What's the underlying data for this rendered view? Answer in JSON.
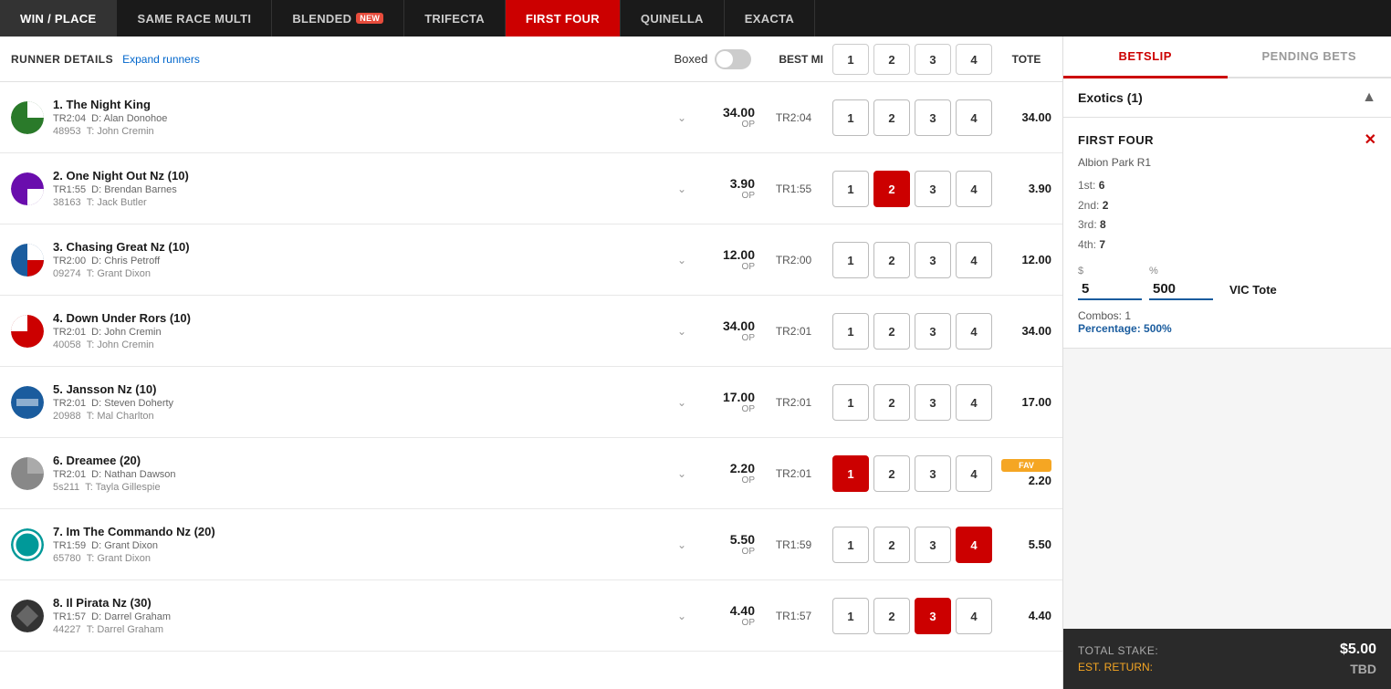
{
  "nav": {
    "tabs": [
      {
        "id": "win-place",
        "label": "WIN / PLACE",
        "active": false
      },
      {
        "id": "same-race-multi",
        "label": "SAME RACE MULTI",
        "active": false
      },
      {
        "id": "blended",
        "label": "BLENDED",
        "active": false,
        "badge": "NEW"
      },
      {
        "id": "trifecta",
        "label": "TRIFECTA",
        "active": false
      },
      {
        "id": "first-four",
        "label": "FIRST FOUR",
        "active": true
      },
      {
        "id": "quinella",
        "label": "QUINELLA",
        "active": false
      },
      {
        "id": "exacta",
        "label": "EXACTA",
        "active": false
      }
    ]
  },
  "table": {
    "runner_details_label": "RUNNER DETAILS",
    "expand_runners_label": "Expand runners",
    "boxed_label": "Boxed",
    "best_mi_label": "BEST MI",
    "tote_label": "Tote",
    "position_headers": [
      "1",
      "2",
      "3",
      "4"
    ]
  },
  "runners": [
    {
      "number": 1,
      "name": "1. The Night King",
      "tr": "TR2:04",
      "driver": "D: Alan Donohoe",
      "trainer": "T: John Cremin",
      "id": "48953",
      "odds": "34.00",
      "odds_type": "OP",
      "runner_tr": "TR2:04",
      "tote": "34.00",
      "silk_class": "silk-green",
      "positions": [
        {
          "label": "1",
          "selected": false
        },
        {
          "label": "2",
          "selected": false
        },
        {
          "label": "3",
          "selected": false
        },
        {
          "label": "4",
          "selected": false
        }
      ],
      "fav": false
    },
    {
      "number": 2,
      "name": "2. One Night Out Nz (10)",
      "tr": "TR1:55",
      "driver": "D: Brendan Barnes",
      "trainer": "T: Jack Butler",
      "id": "38163",
      "odds": "3.90",
      "odds_type": "OP",
      "runner_tr": "TR1:55",
      "tote": "3.90",
      "silk_class": "silk-purple-white",
      "positions": [
        {
          "label": "1",
          "selected": false
        },
        {
          "label": "2",
          "selected": true
        },
        {
          "label": "3",
          "selected": false
        },
        {
          "label": "4",
          "selected": false
        }
      ],
      "fav": false
    },
    {
      "number": 3,
      "name": "3. Chasing Great Nz (10)",
      "tr": "TR2:00",
      "driver": "D: Chris Petroff",
      "trainer": "T: Grant Dixon",
      "id": "09274",
      "odds": "12.00",
      "odds_type": "OP",
      "runner_tr": "TR2:00",
      "tote": "12.00",
      "silk_class": "silk-multi",
      "positions": [
        {
          "label": "1",
          "selected": false
        },
        {
          "label": "2",
          "selected": false
        },
        {
          "label": "3",
          "selected": false
        },
        {
          "label": "4",
          "selected": false
        }
      ],
      "fav": false
    },
    {
      "number": 4,
      "name": "4. Down Under Rors (10)",
      "tr": "TR2:01",
      "driver": "D: John Cremin",
      "trainer": "T: John Cremin",
      "id": "40058",
      "odds": "34.00",
      "odds_type": "OP",
      "runner_tr": "TR2:01",
      "tote": "34.00",
      "silk_class": "silk-red-white",
      "positions": [
        {
          "label": "1",
          "selected": false
        },
        {
          "label": "2",
          "selected": false
        },
        {
          "label": "3",
          "selected": false
        },
        {
          "label": "4",
          "selected": false
        }
      ],
      "fav": false
    },
    {
      "number": 5,
      "name": "5. Jansson Nz (10)",
      "tr": "TR2:01",
      "driver": "D: Steven Doherty",
      "trainer": "T: Mal Charlton",
      "id": "20988",
      "odds": "17.00",
      "odds_type": "OP",
      "runner_tr": "TR2:01",
      "tote": "17.00",
      "silk_class": "silk-blue",
      "positions": [
        {
          "label": "1",
          "selected": false
        },
        {
          "label": "2",
          "selected": false
        },
        {
          "label": "3",
          "selected": false
        },
        {
          "label": "4",
          "selected": false
        }
      ],
      "fav": false
    },
    {
      "number": 6,
      "name": "6. Dreamee (20)",
      "tr": "TR2:01",
      "driver": "D: Nathan Dawson",
      "trainer": "T: Tayla Gillespie",
      "id": "5s211",
      "odds": "2.20",
      "odds_type": "OP",
      "runner_tr": "TR2:01",
      "tote": "2.20",
      "silk_class": "silk-grey",
      "positions": [
        {
          "label": "1",
          "selected": true
        },
        {
          "label": "2",
          "selected": false
        },
        {
          "label": "3",
          "selected": false
        },
        {
          "label": "4",
          "selected": false
        }
      ],
      "fav": true,
      "fav_label": "FAV"
    },
    {
      "number": 7,
      "name": "7. Im The Commando Nz (20)",
      "tr": "TR1:59",
      "driver": "D: Grant Dixon",
      "trainer": "T: Grant Dixon",
      "id": "65780",
      "odds": "5.50",
      "odds_type": "OP",
      "runner_tr": "TR1:59",
      "tote": "5.50",
      "silk_class": "silk-teal",
      "positions": [
        {
          "label": "1",
          "selected": false
        },
        {
          "label": "2",
          "selected": false
        },
        {
          "label": "3",
          "selected": false
        },
        {
          "label": "4",
          "selected": true
        }
      ],
      "fav": false
    },
    {
      "number": 8,
      "name": "8. Il Pirata Nz (30)",
      "tr": "TR1:57",
      "driver": "D: Darrel Graham",
      "trainer": "T: Darrel Graham",
      "id": "44227",
      "odds": "4.40",
      "odds_type": "OP",
      "runner_tr": "TR1:57",
      "tote": "4.40",
      "silk_class": "silk-dark",
      "positions": [
        {
          "label": "1",
          "selected": false
        },
        {
          "label": "2",
          "selected": false
        },
        {
          "label": "3",
          "selected": true
        },
        {
          "label": "4",
          "selected": false
        }
      ],
      "fav": false
    }
  ],
  "betslip": {
    "tabs": [
      {
        "id": "betslip",
        "label": "BETSLIP",
        "active": true
      },
      {
        "id": "pending-bets",
        "label": "PENDING BETS",
        "active": false
      }
    ],
    "exotics_title": "Exotics (1)",
    "bet": {
      "type_label": "FIRST FOUR",
      "venue": "Albion Park R1",
      "positions": [
        {
          "label": "1st:",
          "value": "6"
        },
        {
          "label": "2nd:",
          "value": "2"
        },
        {
          "label": "3rd:",
          "value": "8"
        },
        {
          "label": "4th:",
          "value": "7"
        }
      ],
      "dollar_label": "$",
      "dollar_value": "5",
      "pct_label": "%",
      "pct_value": "500",
      "vic_tote_label": "VIC Tote",
      "combos_label": "Combos:",
      "combos_value": "1",
      "pct_line": "Percentage: 500%"
    },
    "footer": {
      "total_stake_label": "Total Stake:",
      "total_stake_value": "$5.00",
      "est_return_label": "Est. Return:",
      "est_return_value": "TBD"
    }
  }
}
